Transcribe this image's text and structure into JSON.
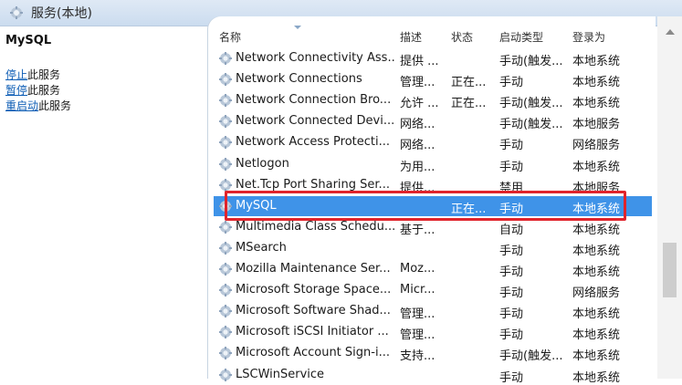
{
  "window": {
    "title": "服务(本地)"
  },
  "left_pane": {
    "service_name": "MySQL",
    "actions": [
      {
        "link": "停止",
        "rest": "此服务"
      },
      {
        "link": "暂停",
        "rest": "此服务"
      },
      {
        "link": "重启动",
        "rest": "此服务"
      }
    ]
  },
  "columns": {
    "name": "名称",
    "desc": "描述",
    "status": "状态",
    "startup": "启动类型",
    "logon": "登录为"
  },
  "rows": [
    {
      "name": "Network Connectivity Ass...",
      "desc": "提供 ...",
      "status": "",
      "startup": "手动(触发...",
      "logon": "本地系统"
    },
    {
      "name": "Network Connections",
      "desc": "管理...",
      "status": "正在...",
      "startup": "手动",
      "logon": "本地系统"
    },
    {
      "name": "Network Connection Bro...",
      "desc": "允许 ...",
      "status": "正在...",
      "startup": "手动(触发...",
      "logon": "本地系统"
    },
    {
      "name": "Network Connected Devi...",
      "desc": "网络...",
      "status": "",
      "startup": "手动(触发...",
      "logon": "本地服务"
    },
    {
      "name": "Network Access Protecti...",
      "desc": "网络...",
      "status": "",
      "startup": "手动",
      "logon": "网络服务"
    },
    {
      "name": "Netlogon",
      "desc": "为用...",
      "status": "",
      "startup": "手动",
      "logon": "本地系统"
    },
    {
      "name": "Net.Tcp Port Sharing Ser...",
      "desc": "提供...",
      "status": "",
      "startup": "禁用",
      "logon": "本地服务"
    },
    {
      "name": "MySQL",
      "desc": "",
      "status": "正在...",
      "startup": "手动",
      "logon": "本地系统"
    },
    {
      "name": "Multimedia Class Schedu...",
      "desc": "基于...",
      "status": "",
      "startup": "自动",
      "logon": "本地系统"
    },
    {
      "name": "MSearch",
      "desc": "",
      "status": "",
      "startup": "手动",
      "logon": "本地系统"
    },
    {
      "name": "Mozilla Maintenance Ser...",
      "desc": "Moz...",
      "status": "",
      "startup": "手动",
      "logon": "本地系统"
    },
    {
      "name": "Microsoft Storage Space...",
      "desc": "Micr...",
      "status": "",
      "startup": "手动",
      "logon": "网络服务"
    },
    {
      "name": "Microsoft Software Shad...",
      "desc": "管理...",
      "status": "",
      "startup": "手动",
      "logon": "本地系统"
    },
    {
      "name": "Microsoft iSCSI Initiator ...",
      "desc": "管理...",
      "status": "",
      "startup": "手动",
      "logon": "本地系统"
    },
    {
      "name": "Microsoft Account Sign-i...",
      "desc": "支持...",
      "status": "",
      "startup": "手动(触发...",
      "logon": "本地系统"
    },
    {
      "name": "LSCWinService",
      "desc": "",
      "status": "",
      "startup": "手动",
      "logon": "本地系统"
    }
  ],
  "selected_index": 7,
  "colors": {
    "selection": "#3f93e8",
    "highlight_border": "#e0242c",
    "link": "#0d5db5"
  },
  "icons": {
    "service": "gear-icon",
    "title": "gear-icon"
  }
}
